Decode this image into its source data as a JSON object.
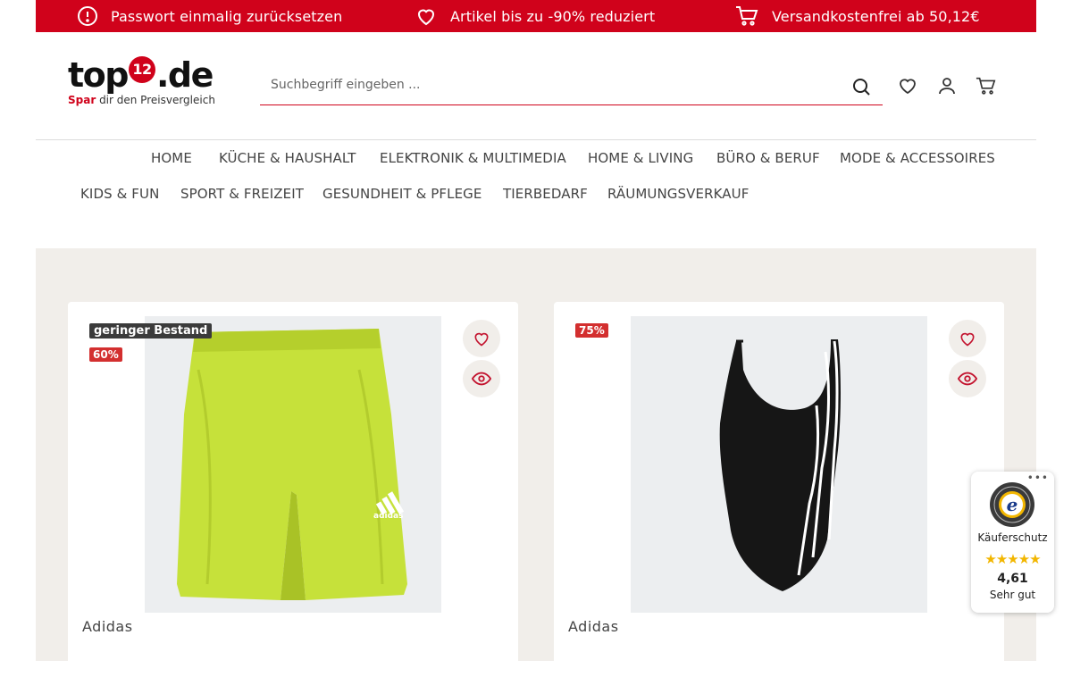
{
  "promo": {
    "reset_password": "Passwort einmalig zurücksetzen",
    "discount": "Artikel bis zu -90% reduziert",
    "shipping": "Versandkostenfrei ab 50,12€"
  },
  "logo": {
    "top": "top",
    "number": "12",
    "domain": ".de",
    "tag_red": "Spar",
    "tag_rest": " dir den Preisvergleich"
  },
  "search": {
    "placeholder": "Suchbegriff eingeben ..."
  },
  "nav": {
    "row1": [
      "HOME",
      "KÜCHE & HAUSHALT",
      "ELEKTRONIK & MULTIMEDIA",
      "HOME & LIVING",
      "BÜRO & BERUF",
      "MODE & ACCESSOIRES"
    ],
    "row2": [
      "KIDS & FUN",
      "SPORT & FREIZEIT",
      "GESUNDHEIT & PFLEGE",
      "TIERBEDARF",
      "RÄUMUNGSVERKAUF"
    ]
  },
  "products": [
    {
      "stock_badge": "geringer Bestand",
      "discount": "60%",
      "brand": "Adidas",
      "image_icon": "swim-shorts-image"
    },
    {
      "stock_badge": "",
      "discount": "75%",
      "brand": "Adidas",
      "image_icon": "swimsuit-image"
    }
  ],
  "trusted_shops": {
    "dots": "•••",
    "label": "Käuferschutz",
    "stars": "★★★★★",
    "score": "4,61",
    "rating_text": "Sehr gut"
  },
  "colors": {
    "brand_red": "#d0021b",
    "product_bg": "#f1eeea",
    "star_yellow": "#f2b600"
  }
}
